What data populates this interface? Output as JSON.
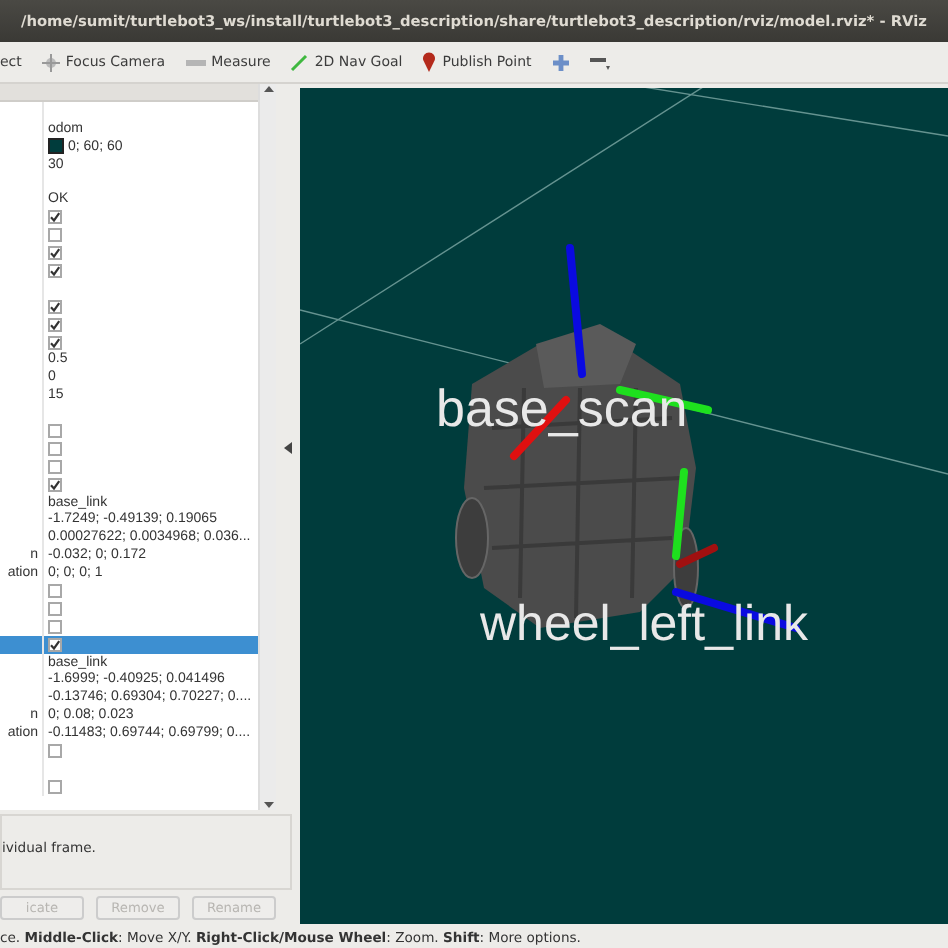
{
  "window": {
    "title": "/home/sumit/turtlebot3_ws/install/turtlebot3_description/share/turtlebot3_description/rviz/model.rviz* - RViz"
  },
  "toolbar": {
    "tools": [
      {
        "kind": "select",
        "label": "ect"
      },
      {
        "kind": "focus",
        "label": "Focus Camera"
      },
      {
        "kind": "measure",
        "label": "Measure"
      },
      {
        "kind": "goal",
        "label": "2D Nav Goal"
      },
      {
        "kind": "point",
        "label": "Publish Point"
      },
      {
        "kind": "add"
      },
      {
        "kind": "remove"
      }
    ]
  },
  "properties": {
    "rows": [
      {
        "kind": "blank"
      },
      {
        "kind": "text",
        "value": "odom"
      },
      {
        "kind": "color",
        "value": "0; 60; 60",
        "color": "#003c3c"
      },
      {
        "kind": "text",
        "value": "30"
      },
      {
        "kind": "blank"
      },
      {
        "kind": "text",
        "value": "OK"
      },
      {
        "kind": "check",
        "checked": true,
        "selected": false
      },
      {
        "kind": "check",
        "checked": false,
        "selected": false
      },
      {
        "kind": "check",
        "checked": true,
        "selected": false
      },
      {
        "kind": "check",
        "checked": true,
        "selected": false
      },
      {
        "kind": "blank"
      },
      {
        "kind": "check",
        "checked": true,
        "selected": false
      },
      {
        "kind": "check",
        "checked": true,
        "selected": false
      },
      {
        "kind": "check",
        "checked": true,
        "selected": false
      },
      {
        "kind": "text",
        "value": "0.5"
      },
      {
        "kind": "text",
        "value": "0"
      },
      {
        "kind": "text",
        "value": "15"
      },
      {
        "kind": "blank"
      },
      {
        "kind": "check",
        "checked": false,
        "selected": false
      },
      {
        "kind": "check",
        "checked": false,
        "selected": false
      },
      {
        "kind": "check",
        "checked": false,
        "selected": false
      },
      {
        "kind": "check",
        "checked": true,
        "selected": false
      },
      {
        "kind": "text",
        "value": "base_link"
      },
      {
        "kind": "text",
        "value": "-1.7249; -0.49139; 0.19065"
      },
      {
        "kind": "text",
        "value": "0.00027622; 0.0034968; 0.036..."
      },
      {
        "kind": "text",
        "name": "n",
        "value": "-0.032; 0; 0.172"
      },
      {
        "kind": "text",
        "name": "ation",
        "value": "0; 0; 0; 1"
      },
      {
        "kind": "check",
        "checked": false,
        "selected": false
      },
      {
        "kind": "check",
        "checked": false,
        "selected": false
      },
      {
        "kind": "check",
        "checked": false,
        "selected": false
      },
      {
        "kind": "check",
        "checked": true,
        "selected": true
      },
      {
        "kind": "text",
        "value": "base_link"
      },
      {
        "kind": "text",
        "value": "-1.6999; -0.40925; 0.041496"
      },
      {
        "kind": "text",
        "value": "-0.13746; 0.69304; 0.70227; 0...."
      },
      {
        "kind": "text",
        "name": "n",
        "value": "0; 0.08; 0.023"
      },
      {
        "kind": "text",
        "name": "ation",
        "value": "-0.11483; 0.69744; 0.69799; 0...."
      },
      {
        "kind": "check",
        "checked": false,
        "selected": false
      },
      {
        "kind": "blank"
      },
      {
        "kind": "check",
        "checked": false,
        "selected": false
      }
    ]
  },
  "description": "ividual frame.",
  "buttons": [
    {
      "label": "icate",
      "disabled": true
    },
    {
      "label": "Remove",
      "disabled": true
    },
    {
      "label": "Rename",
      "disabled": true
    }
  ],
  "viewport": {
    "frame_labels": [
      "base_scan",
      "wheel_left_link"
    ]
  },
  "status_bar": "ce. **Middle-Click**: Move X/Y. **Right-Click/Mouse Wheel**: Zoom. **Shift**: More options."
}
